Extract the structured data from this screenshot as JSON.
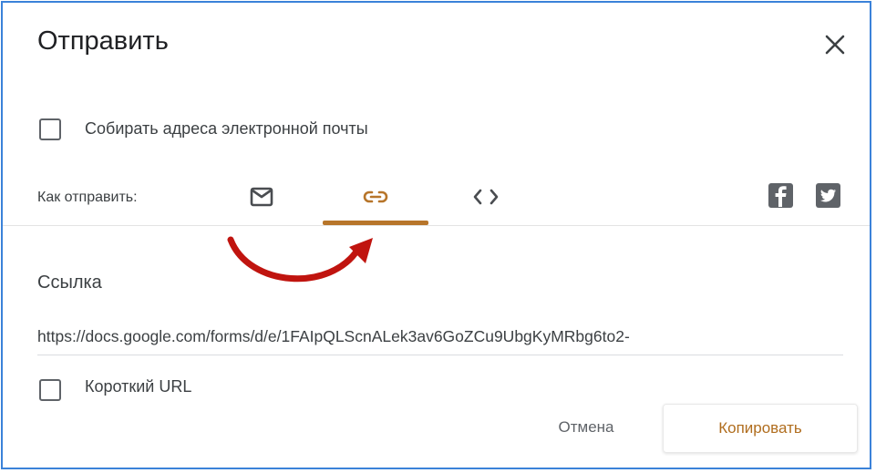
{
  "dialog": {
    "title": "Отправить",
    "close_label": "×"
  },
  "collect_emails": {
    "label": "Собирать адреса электронной почты",
    "checked": false
  },
  "send_via": {
    "label": "Как отправить:",
    "tabs": [
      {
        "name": "email",
        "icon": "mail-icon",
        "selected": false
      },
      {
        "name": "link",
        "icon": "link-icon",
        "selected": true
      },
      {
        "name": "embed",
        "icon": "code-icon",
        "selected": false
      }
    ],
    "social": [
      {
        "name": "facebook",
        "icon": "facebook-icon"
      },
      {
        "name": "twitter",
        "icon": "twitter-icon"
      }
    ]
  },
  "link_section": {
    "title": "Ссылка",
    "url": "https://docs.google.com/forms/d/e/1FAIpQLScnALek3av6GoZCu9UbgKyMRbg6to2-",
    "short_url_label": "Короткий URL",
    "short_url_checked": false
  },
  "actions": {
    "cancel_label": "Отмена",
    "copy_label": "Копировать"
  },
  "colors": {
    "accent": "#b7752a",
    "frame": "#3b82d9",
    "annotation_arrow": "#c0140f"
  }
}
